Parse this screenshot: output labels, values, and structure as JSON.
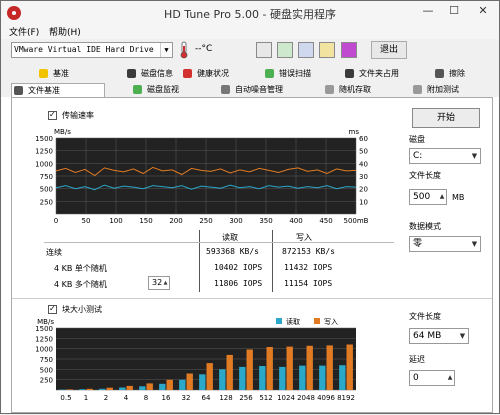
{
  "window": {
    "title": "HD Tune Pro 5.00 - 硬盘实用程序",
    "min": "—",
    "max": "☐",
    "close": "✕"
  },
  "menu": {
    "file": "文件(F)",
    "help": "帮助(H)"
  },
  "toolbar": {
    "drive": "VMware Virtual IDE Hard Drive (42",
    "temperature": "--°C",
    "exit": "退出",
    "icons": [
      "copy-icon",
      "paste-icon",
      "save-icon",
      "options-icon",
      "download-icon"
    ]
  },
  "tabs_top": [
    "基准",
    "磁盘信息",
    "健康状况",
    "错误扫描",
    "文件夹占用",
    "擦除"
  ],
  "tabs_bottom": [
    "文件基准",
    "磁盘监视",
    "自动噪音管理",
    "随机存取",
    "附加测试"
  ],
  "colors": {
    "read": "#2aa7c9",
    "write": "#e07b24",
    "plot_bg": "#222",
    "grid": "#5a5a5a"
  },
  "transfer": {
    "checkbox_label": "传输速率",
    "left_unit": "MB/s",
    "right_unit": "ms",
    "y_left_ticks": [
      "1500",
      "1250",
      "1000",
      "750",
      "500",
      "250"
    ],
    "y_right_ticks": [
      "60",
      "50",
      "40",
      "30",
      "20",
      "10"
    ],
    "x_ticks": [
      "0",
      "50",
      "100",
      "150",
      "200",
      "250",
      "300",
      "350",
      "400",
      "450",
      "500mB"
    ]
  },
  "stats": {
    "col_read": "读取",
    "col_write": "写入",
    "rows": [
      {
        "label": "连续",
        "read": "593368 KB/s",
        "write": "872153 KB/s"
      },
      {
        "label": "4 KB 单个随机",
        "read": "10402 IOPS",
        "write": "11432 IOPS"
      },
      {
        "label": "4 KB 多个随机",
        "read": "11806 IOPS",
        "write": "11154 IOPS"
      }
    ],
    "queue_depth": "32"
  },
  "right": {
    "start": "开始",
    "disk_label": "磁盘",
    "disk_value": "C:",
    "filelen_label": "文件长度",
    "filelen_value": "500",
    "filelen_unit": "MB",
    "pattern_label": "数据模式",
    "pattern_value": "零",
    "filelen2_label": "文件长度",
    "filelen2_value": "64 MB",
    "delay_label": "延迟",
    "delay_value": "0"
  },
  "blocks": {
    "checkbox_label": "块大小测试",
    "unit": "MB/s",
    "legend_read": "读取",
    "legend_write": "写入",
    "y_ticks": [
      "1500",
      "1250",
      "1000",
      "750",
      "500",
      "250"
    ]
  },
  "chart_data": [
    {
      "type": "line",
      "title": "",
      "xlabel": "",
      "ylabel": "MB/s",
      "xlim": [
        0,
        500
      ],
      "ylim": [
        0,
        1500
      ],
      "series": [
        {
          "name": "",
          "values": [
            850,
            900,
            820,
            880,
            760,
            910,
            860,
            830,
            890,
            800,
            920,
            850,
            870,
            780,
            900,
            860,
            840,
            890,
            810,
            870,
            830,
            900,
            860,
            820,
            880,
            910,
            840,
            870,
            800,
            890,
            850,
            860
          ]
        },
        {
          "name": "",
          "values": [
            520,
            560,
            500,
            540,
            480,
            570,
            510,
            550,
            530,
            500,
            560,
            540,
            520,
            560,
            490,
            550,
            530,
            510,
            570,
            520,
            540,
            500,
            560,
            530,
            550,
            510,
            540,
            520,
            560,
            500,
            540,
            530
          ]
        }
      ]
    },
    {
      "type": "bar",
      "title": "",
      "xlabel": "",
      "ylabel": "MB/s",
      "ylim": [
        0,
        1500
      ],
      "categories": [
        "0.5",
        "1",
        "2",
        "4",
        "8",
        "16",
        "32",
        "64",
        "128",
        "256",
        "512",
        "1024",
        "2048",
        "4096",
        "8192"
      ],
      "series": [
        {
          "name": "读取",
          "values": [
            10,
            20,
            30,
            60,
            90,
            150,
            250,
            380,
            500,
            560,
            580,
            560,
            590,
            590,
            600
          ]
        },
        {
          "name": "写入",
          "values": [
            15,
            30,
            55,
            100,
            160,
            250,
            400,
            650,
            850,
            980,
            1040,
            1050,
            1070,
            1080,
            1100
          ]
        }
      ]
    }
  ]
}
